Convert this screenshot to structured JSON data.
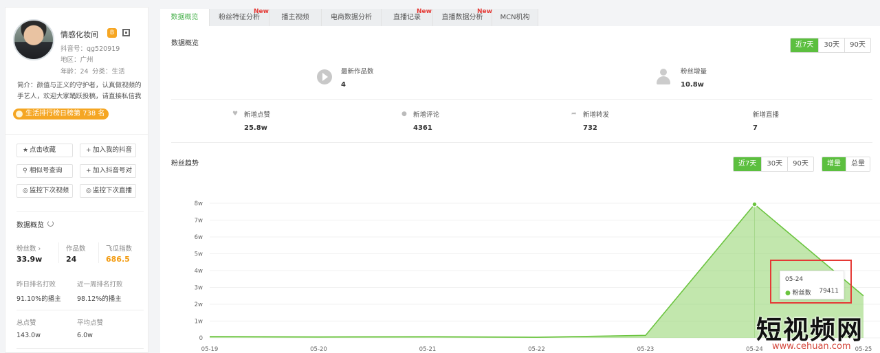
{
  "profile": {
    "name": "情感化妆间",
    "douyin_id": "抖音号：qg520919",
    "region": "地区：广州",
    "age": "年龄：24",
    "category": "分类：生活",
    "bio": "简介：颜值与正义的守护者，认真做视频的手艺人，欢迎大家踊跃投稿，请直接私信我",
    "rank_badge": "生活排行榜日榜第 738 名"
  },
  "actions": {
    "favorite": "点击收藏",
    "add_mine": "加入我的抖音",
    "similar": "相似号查询",
    "add_compare": "加入抖音号对",
    "monitor_video": "监控下次视频",
    "monitor_live": "监控下次直播"
  },
  "sidebar_stats": {
    "title": "数据概览",
    "fans_label": "粉丝数 ›",
    "fans": "33.9w",
    "works_label": "作品数",
    "works": "24",
    "index_label": "飞瓜指数",
    "index": "686.5",
    "yday_rank_label": "昨日排名打败",
    "yday_rank": "91.10%的播主",
    "week_rank_label": "近一周排名打败",
    "week_rank": "98.12%的播主",
    "total_likes_label": "总点赞",
    "total_likes": "143.0w",
    "avg_likes_label": "平均点赞",
    "avg_likes": "6.0w"
  },
  "tabs": [
    {
      "label": "数据概览",
      "new": ""
    },
    {
      "label": "粉丝特征分析",
      "new": "New"
    },
    {
      "label": "播主视频",
      "new": ""
    },
    {
      "label": "电商数据分析",
      "new": ""
    },
    {
      "label": "直播记录",
      "new": "New"
    },
    {
      "label": "直播数据分析",
      "new": "New"
    },
    {
      "label": "MCN机构",
      "new": ""
    }
  ],
  "overview": {
    "title": "数据概览",
    "range": [
      "近7天",
      "30天",
      "90天"
    ],
    "new_works_label": "最新作品数",
    "new_works": "4",
    "fans_growth_label": "粉丝增量",
    "fans_growth": "10.8w",
    "new_likes_label": "新增点赞",
    "new_likes": "25.8w",
    "new_comments_label": "新增评论",
    "new_comments": "4361",
    "new_shares_label": "新增转发",
    "new_shares": "732",
    "new_lives_label": "新增直播",
    "new_lives": "7"
  },
  "trend": {
    "title": "粉丝趋势",
    "range": [
      "近7天",
      "30天",
      "90天"
    ],
    "mode": [
      "增量",
      "总量"
    ],
    "tooltip_date": "05-24",
    "tooltip_series": "粉丝数",
    "tooltip_value": "79411"
  },
  "chart_data": {
    "type": "area",
    "title": "粉丝趋势",
    "x": [
      "05-19",
      "05-20",
      "05-21",
      "05-22",
      "05-23",
      "05-24",
      "05-25"
    ],
    "series": [
      {
        "name": "粉丝数",
        "values": [
          800,
          600,
          700,
          400,
          1500,
          79411,
          25000
        ]
      }
    ],
    "yticks": [
      "0",
      "1w",
      "2w",
      "3w",
      "4w",
      "5w",
      "6w",
      "7w",
      "8w"
    ],
    "ylim": [
      0,
      80000
    ],
    "grid": true,
    "color": "#8fd36a"
  },
  "watermark": {
    "text": "短视频网",
    "url": "www.cehuan.com"
  }
}
